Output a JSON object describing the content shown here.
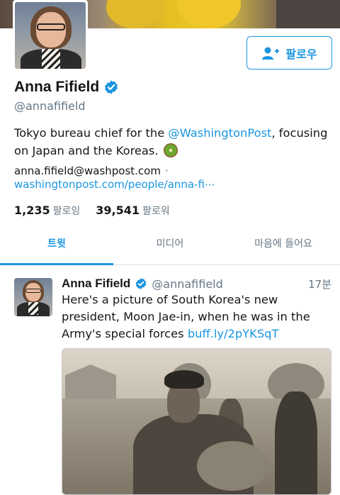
{
  "profile": {
    "name": "Anna Fifield",
    "handle": "@annafifield",
    "bio_prefix": "Tokyo bureau chief for the ",
    "bio_mention": "@WashingtonPost",
    "bio_suffix": ", focusing on Japan and the Koreas.",
    "email": "anna.fifield@washpost.com",
    "separator": "·",
    "website": "washingtonpost.com/people/anna-fi⋯",
    "follow_label": "팔로우",
    "following_count": "1,235",
    "following_label": "팔로잉",
    "followers_count": "39,541",
    "followers_label": "팔로워"
  },
  "tabs": [
    {
      "label": "트윗",
      "active": true
    },
    {
      "label": "미디어",
      "active": false
    },
    {
      "label": "마음에 들어요",
      "active": false
    }
  ],
  "tweet": {
    "name": "Anna Fifield",
    "handle": "@annafifield",
    "time": "17분",
    "text": "Here's a picture of South Korea's new president, Moon Jae-in, when he was in the Army's special forces ",
    "link": "buff.ly/2pYKSqT"
  },
  "colors": {
    "accent": "#1b95e0",
    "secondary_text": "#657786"
  }
}
